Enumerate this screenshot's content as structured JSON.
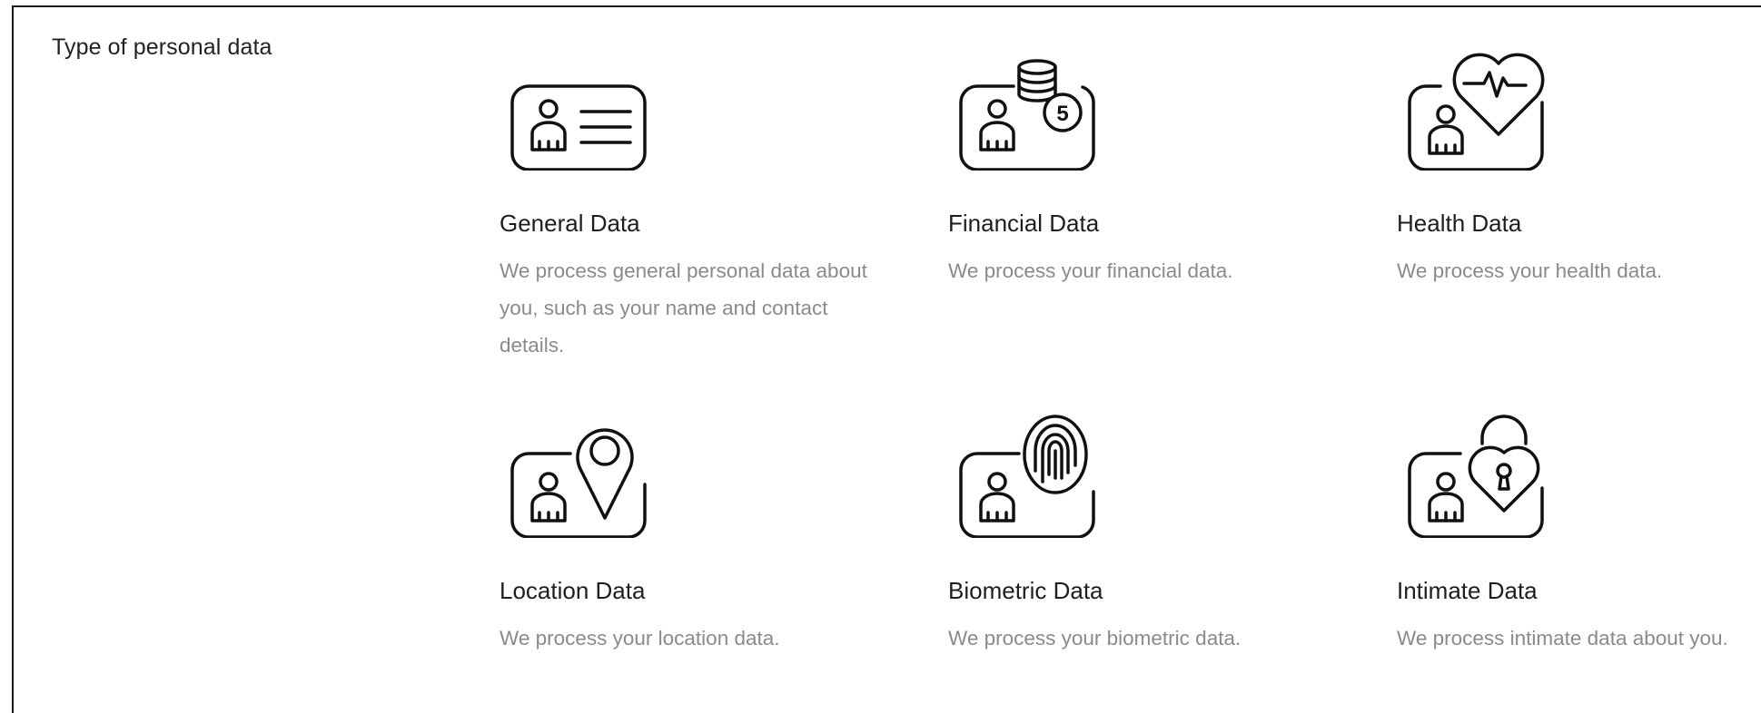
{
  "section": {
    "label": "Type of personal data"
  },
  "categories": [
    {
      "icon": "id-card-icon",
      "title": "General Data",
      "description": "We process general personal data about you, such as your name and contact details."
    },
    {
      "icon": "coins-card-icon",
      "title": "Financial Data",
      "description": "We process your financial data."
    },
    {
      "icon": "heart-card-icon",
      "title": "Health Data",
      "description": "We process your health data."
    },
    {
      "icon": "location-pin-card-icon",
      "title": "Location Data",
      "description": "We process your location data."
    },
    {
      "icon": "fingerprint-card-icon",
      "title": "Biometric Data",
      "description": "We process your biometric data."
    },
    {
      "icon": "heart-lock-card-icon",
      "title": "Intimate Data",
      "description": "We process intimate data about you."
    }
  ],
  "colors": {
    "text": "#1e1e1e",
    "muted": "#8a8a8a",
    "icon_stroke": "#111111"
  }
}
